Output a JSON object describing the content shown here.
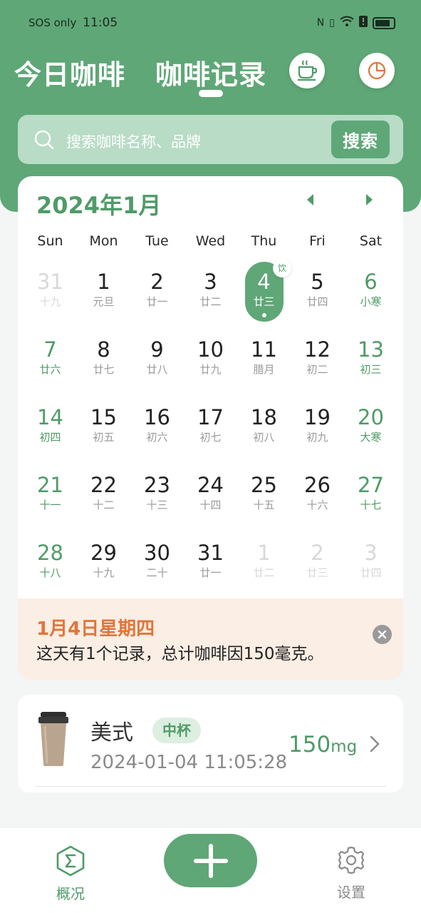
{
  "status_bar": {
    "carrier": "SOS only",
    "time": "11:05"
  },
  "header": {
    "tab_today": "今日咖啡",
    "tab_records": "咖啡记录",
    "cup_icon": "coffee-cup-icon",
    "stats_icon": "pie-chart-icon"
  },
  "search": {
    "placeholder": "搜索咖啡名称、品牌",
    "button_label": "搜索"
  },
  "calendar": {
    "month_title": "2024年1月",
    "weekdays": [
      "Sun",
      "Mon",
      "Tue",
      "Wed",
      "Thu",
      "Fri",
      "Sat"
    ],
    "selected_badge": "饮",
    "days": [
      {
        "d": "31",
        "l": "十九",
        "other": true
      },
      {
        "d": "1",
        "l": "元旦"
      },
      {
        "d": "2",
        "l": "廿一"
      },
      {
        "d": "3",
        "l": "廿二"
      },
      {
        "d": "4",
        "l": "廿三",
        "selected": true
      },
      {
        "d": "5",
        "l": "廿四"
      },
      {
        "d": "6",
        "l": "小寒"
      },
      {
        "d": "7",
        "l": "廿六"
      },
      {
        "d": "8",
        "l": "廿七"
      },
      {
        "d": "9",
        "l": "廿八"
      },
      {
        "d": "10",
        "l": "廿九"
      },
      {
        "d": "11",
        "l": "腊月"
      },
      {
        "d": "12",
        "l": "初二"
      },
      {
        "d": "13",
        "l": "初三"
      },
      {
        "d": "14",
        "l": "初四"
      },
      {
        "d": "15",
        "l": "初五"
      },
      {
        "d": "16",
        "l": "初六"
      },
      {
        "d": "17",
        "l": "初七"
      },
      {
        "d": "18",
        "l": "初八"
      },
      {
        "d": "19",
        "l": "初九"
      },
      {
        "d": "20",
        "l": "大寒"
      },
      {
        "d": "21",
        "l": "十一"
      },
      {
        "d": "22",
        "l": "十二"
      },
      {
        "d": "23",
        "l": "十三"
      },
      {
        "d": "24",
        "l": "十四"
      },
      {
        "d": "25",
        "l": "十五"
      },
      {
        "d": "26",
        "l": "十六"
      },
      {
        "d": "27",
        "l": "十七"
      },
      {
        "d": "28",
        "l": "十八"
      },
      {
        "d": "29",
        "l": "十九"
      },
      {
        "d": "30",
        "l": "二十"
      },
      {
        "d": "31",
        "l": "廿一"
      },
      {
        "d": "1",
        "l": "廿二",
        "other": true
      },
      {
        "d": "2",
        "l": "廿三",
        "other": true
      },
      {
        "d": "3",
        "l": "廿四",
        "other": true
      }
    ]
  },
  "summary": {
    "date": "1月4日星期四",
    "text": "这天有1个记录，总计咖啡因150毫克。"
  },
  "record": {
    "name": "美式",
    "size": "中杯",
    "time": "2024-01-04 11:05:28",
    "amount": "150",
    "unit": "mg"
  },
  "bottom_nav": {
    "overview_label": "概况",
    "settings_label": "设置"
  },
  "colors": {
    "primary": "#5fa777",
    "accent_orange": "#e0753b",
    "summary_bg": "#fbeee4"
  }
}
